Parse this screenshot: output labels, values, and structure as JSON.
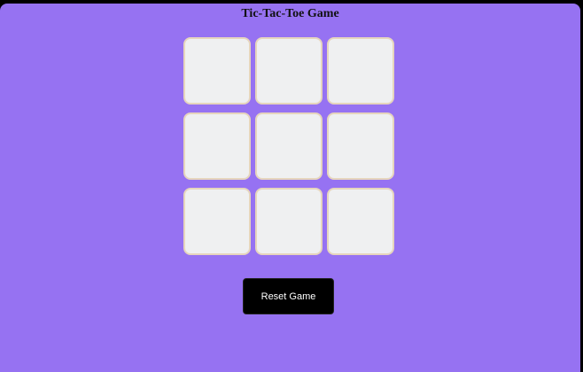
{
  "game": {
    "title": "Tic-Tac-Toe Game",
    "board": {
      "rows": 3,
      "columns": 3,
      "cells": [
        "",
        "",
        "",
        "",
        "",
        "",
        "",
        "",
        ""
      ]
    },
    "reset_label": "Reset Game"
  },
  "colors": {
    "background": "#9672f2",
    "cell_fill": "#eff0f1",
    "cell_border": "#e6d5bd",
    "button_fill": "#000000",
    "button_text": "#ffffff"
  }
}
